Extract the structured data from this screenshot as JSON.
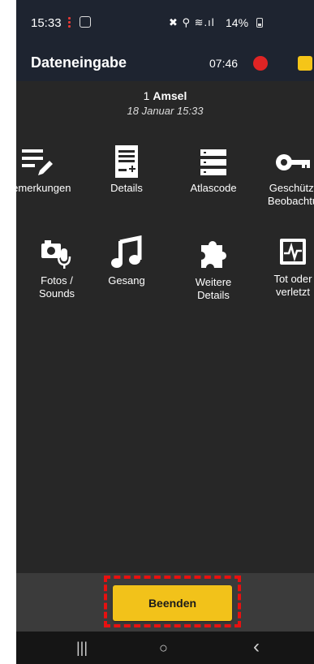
{
  "status_bar": {
    "time": "15:33",
    "network_icons": "✖ ⚲ ≋.ıl",
    "battery": "14%"
  },
  "app_bar": {
    "title": "Dateneingabe",
    "timer": "07:46"
  },
  "record": {
    "species_count": "1",
    "species_name": "Amsel",
    "datetime": "18 Januar 15:33"
  },
  "tiles_row1": [
    {
      "label": "Bemerkungen",
      "icon": "notes-edit-icon"
    },
    {
      "label": "Details",
      "icon": "document-add-icon"
    },
    {
      "label": "Atlascode",
      "icon": "list-icon"
    },
    {
      "label": "Geschützt\nBeobachtu",
      "icon": "key-icon"
    }
  ],
  "tiles_row2": [
    {
      "label": "Fotos /\nSounds",
      "icon": "camera-mic-icon"
    },
    {
      "label": "Gesang",
      "icon": "music-note-icon"
    },
    {
      "label": "Weitere\nDetails",
      "icon": "puzzle-icon"
    },
    {
      "label": "Tot oder\nverletzt",
      "icon": "monitor-heartbeat-icon"
    }
  ],
  "footer": {
    "end_button": "Beenden"
  },
  "nav": {
    "recents": "|||",
    "home": "○",
    "back": "‹"
  },
  "colors": {
    "background": "#272727",
    "bar": "#1e2430",
    "accent_yellow": "#f2c21a",
    "record_red": "#e02424",
    "highlight": "#e81010"
  }
}
